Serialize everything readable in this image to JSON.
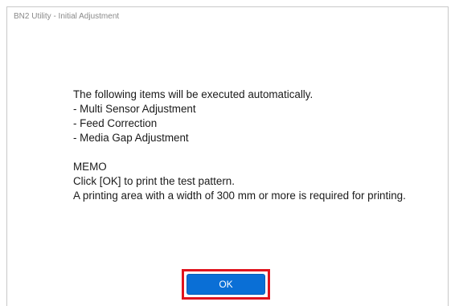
{
  "window": {
    "title": "BN2 Utility - Initial Adjustment"
  },
  "message": {
    "intro": "The following items will be executed automatically.",
    "items": [
      "- Multi Sensor Adjustment",
      "- Feed Correction",
      "- Media Gap Adjustment"
    ],
    "memo_heading": "MEMO",
    "memo_lines": [
      "Click [OK] to print the test pattern.",
      "A printing area with a width of 300 mm or more is required for printing."
    ]
  },
  "buttons": {
    "ok_label": "OK"
  },
  "colors": {
    "button_bg": "#0a6fd6",
    "highlight": "#e0141e",
    "title_text": "#8a8a8a"
  }
}
